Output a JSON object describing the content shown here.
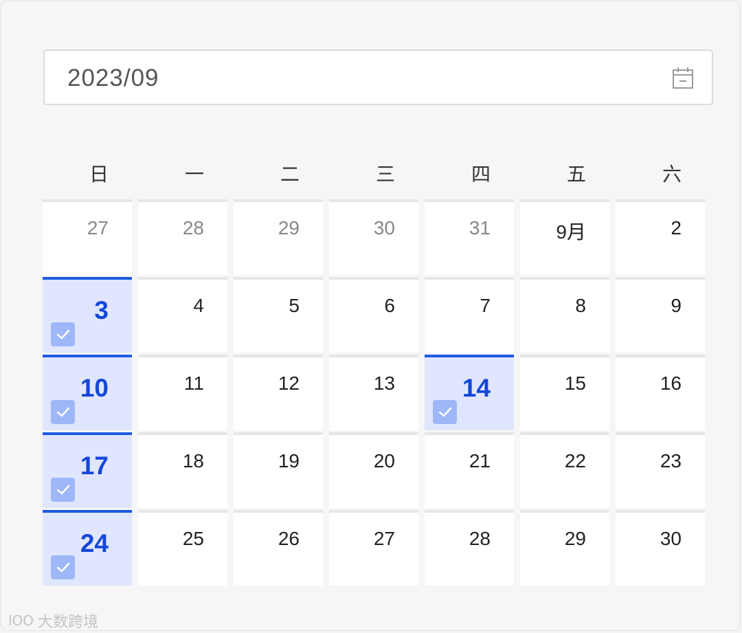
{
  "month_input": {
    "value": "2023/09",
    "icon": "calendar-icon"
  },
  "weekdays": [
    "日",
    "一",
    "二",
    "三",
    "四",
    "五",
    "六"
  ],
  "weeks": [
    [
      {
        "label": "27",
        "muted": true,
        "selected": false
      },
      {
        "label": "28",
        "muted": true,
        "selected": false
      },
      {
        "label": "29",
        "muted": true,
        "selected": false
      },
      {
        "label": "30",
        "muted": true,
        "selected": false
      },
      {
        "label": "31",
        "muted": true,
        "selected": false
      },
      {
        "label": "9月",
        "muted": false,
        "selected": false
      },
      {
        "label": "2",
        "muted": false,
        "selected": false
      }
    ],
    [
      {
        "label": "3",
        "muted": false,
        "selected": true
      },
      {
        "label": "4",
        "muted": false,
        "selected": false
      },
      {
        "label": "5",
        "muted": false,
        "selected": false
      },
      {
        "label": "6",
        "muted": false,
        "selected": false
      },
      {
        "label": "7",
        "muted": false,
        "selected": false
      },
      {
        "label": "8",
        "muted": false,
        "selected": false
      },
      {
        "label": "9",
        "muted": false,
        "selected": false
      }
    ],
    [
      {
        "label": "10",
        "muted": false,
        "selected": true
      },
      {
        "label": "11",
        "muted": false,
        "selected": false
      },
      {
        "label": "12",
        "muted": false,
        "selected": false
      },
      {
        "label": "13",
        "muted": false,
        "selected": false
      },
      {
        "label": "14",
        "muted": false,
        "selected": true
      },
      {
        "label": "15",
        "muted": false,
        "selected": false
      },
      {
        "label": "16",
        "muted": false,
        "selected": false
      }
    ],
    [
      {
        "label": "17",
        "muted": false,
        "selected": true
      },
      {
        "label": "18",
        "muted": false,
        "selected": false
      },
      {
        "label": "19",
        "muted": false,
        "selected": false
      },
      {
        "label": "20",
        "muted": false,
        "selected": false
      },
      {
        "label": "21",
        "muted": false,
        "selected": false
      },
      {
        "label": "22",
        "muted": false,
        "selected": false
      },
      {
        "label": "23",
        "muted": false,
        "selected": false
      }
    ],
    [
      {
        "label": "24",
        "muted": false,
        "selected": true
      },
      {
        "label": "25",
        "muted": false,
        "selected": false
      },
      {
        "label": "26",
        "muted": false,
        "selected": false
      },
      {
        "label": "27",
        "muted": false,
        "selected": false
      },
      {
        "label": "28",
        "muted": false,
        "selected": false
      },
      {
        "label": "29",
        "muted": false,
        "selected": false
      },
      {
        "label": "30",
        "muted": false,
        "selected": false
      }
    ]
  ],
  "colors": {
    "accent": "#1d5ae0",
    "selected_bg": "#e0e6fd",
    "check_bg": "#9db7f9"
  },
  "watermark": {
    "text": "大数跨境",
    "logo": "lOO"
  }
}
